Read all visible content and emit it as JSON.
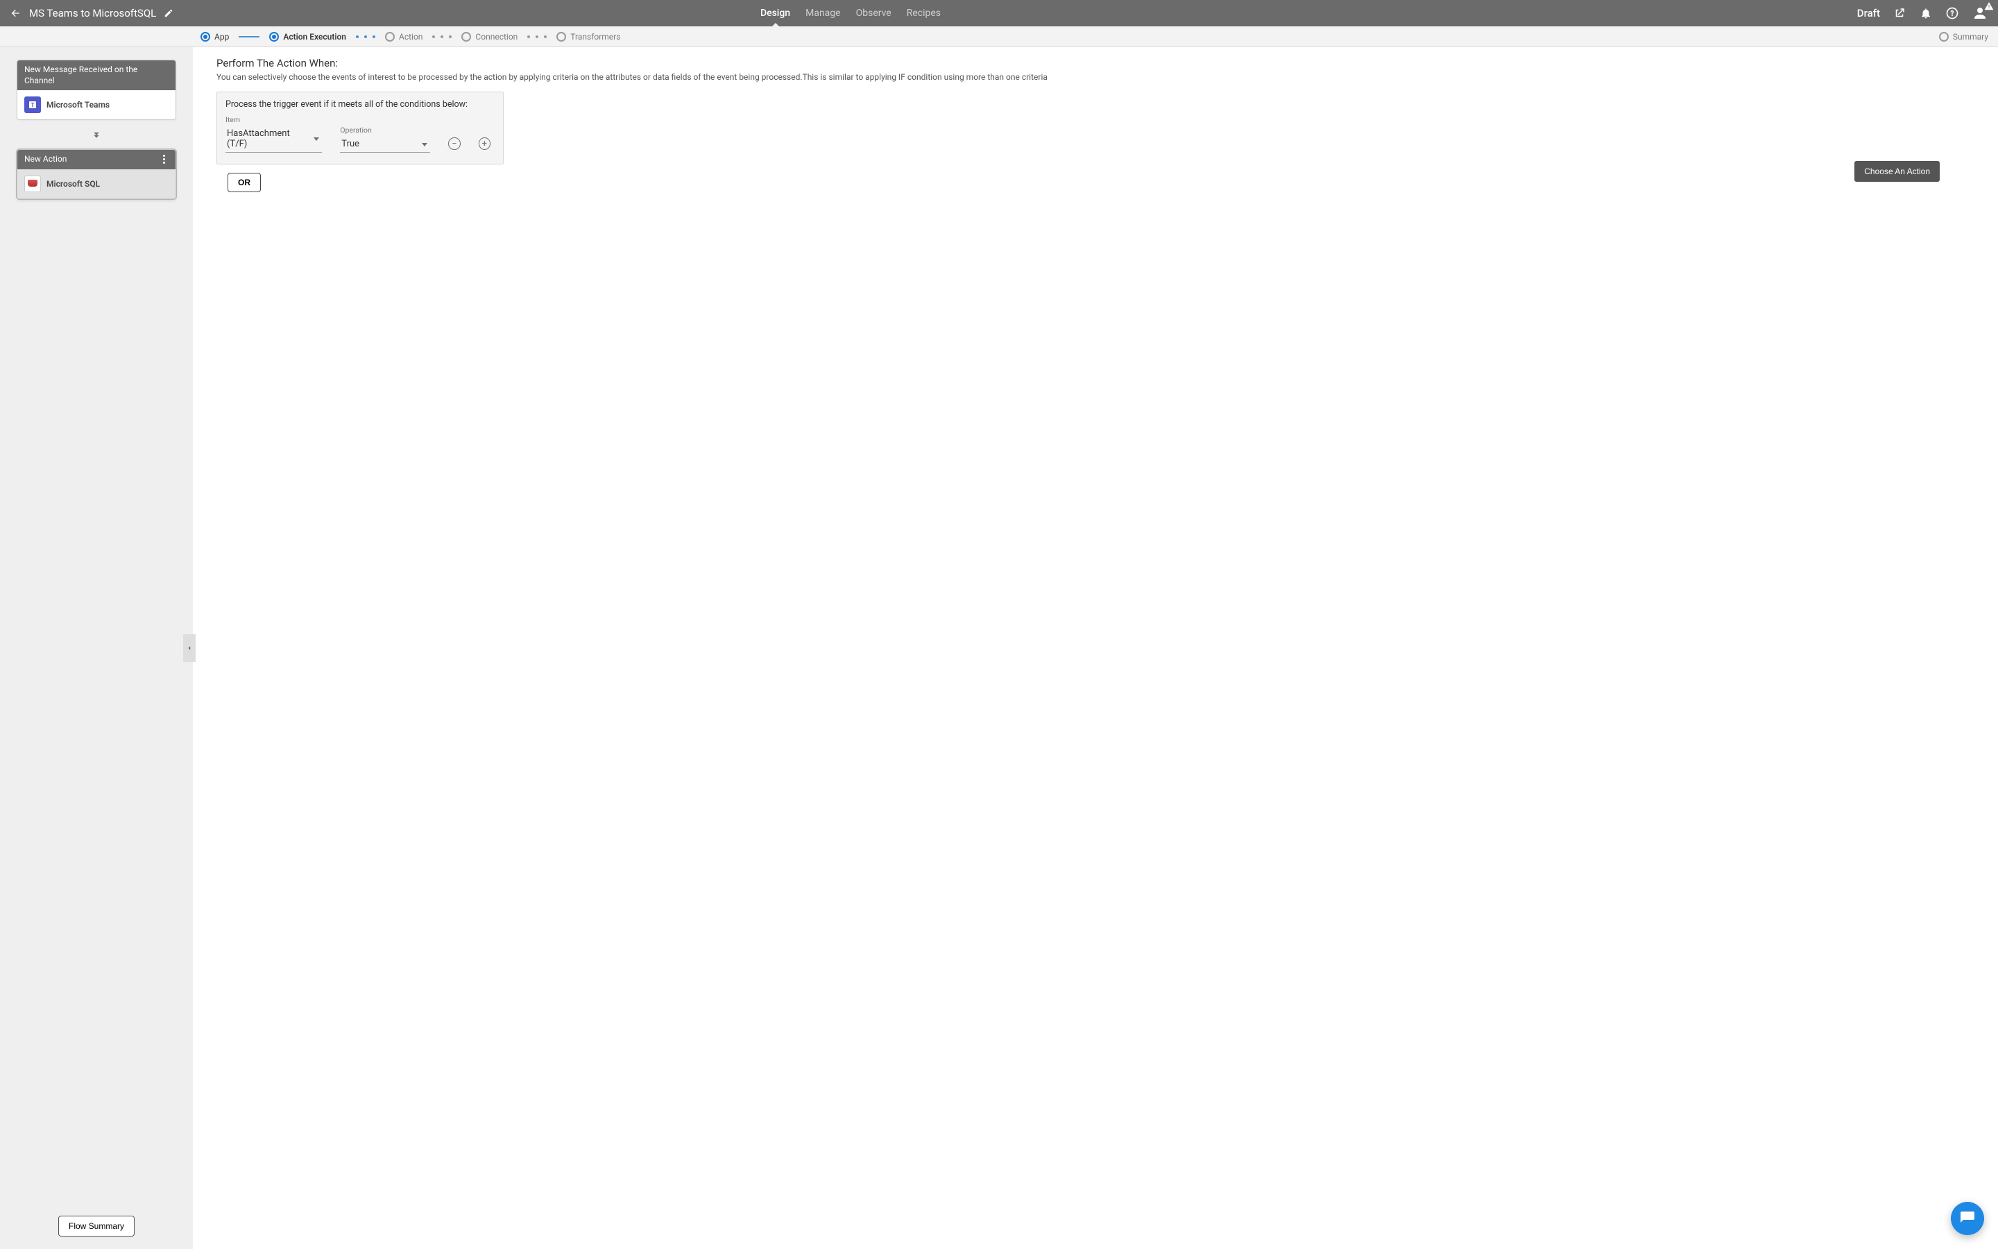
{
  "header": {
    "title": "MS Teams to MicrosoftSQL",
    "tabs": [
      "Design",
      "Manage",
      "Observe",
      "Recipes"
    ],
    "active_tab": 0,
    "status": "Draft"
  },
  "steps": [
    {
      "label": "App",
      "state": "done"
    },
    {
      "label": "Action Execution",
      "state": "current"
    },
    {
      "label": "Action",
      "state": "pending"
    },
    {
      "label": "Connection",
      "state": "pending"
    },
    {
      "label": "Transformers",
      "state": "pending"
    },
    {
      "label": "Summary",
      "state": "pending"
    }
  ],
  "sidebar": {
    "trigger": {
      "title": "New Message Received on the Channel",
      "app": "Microsoft Teams"
    },
    "action": {
      "title": "New Action",
      "app": "Microsoft SQL"
    },
    "flow_summary_label": "Flow Summary"
  },
  "content": {
    "section_title": "Perform The Action When:",
    "section_desc": "You can selectively choose the events of interest to be processed by the action by applying criteria on the attributes or data fields of the event being processed.This is similar to applying IF condition using more than one criteria",
    "condition_caption": "Process the trigger event if it meets all of the conditions below:",
    "item_label": "Item",
    "operation_label": "Operation",
    "item_value": "HasAttachment (T/F)",
    "operation_value": "True",
    "or_label": "OR",
    "choose_action_label": "Choose An Action"
  }
}
